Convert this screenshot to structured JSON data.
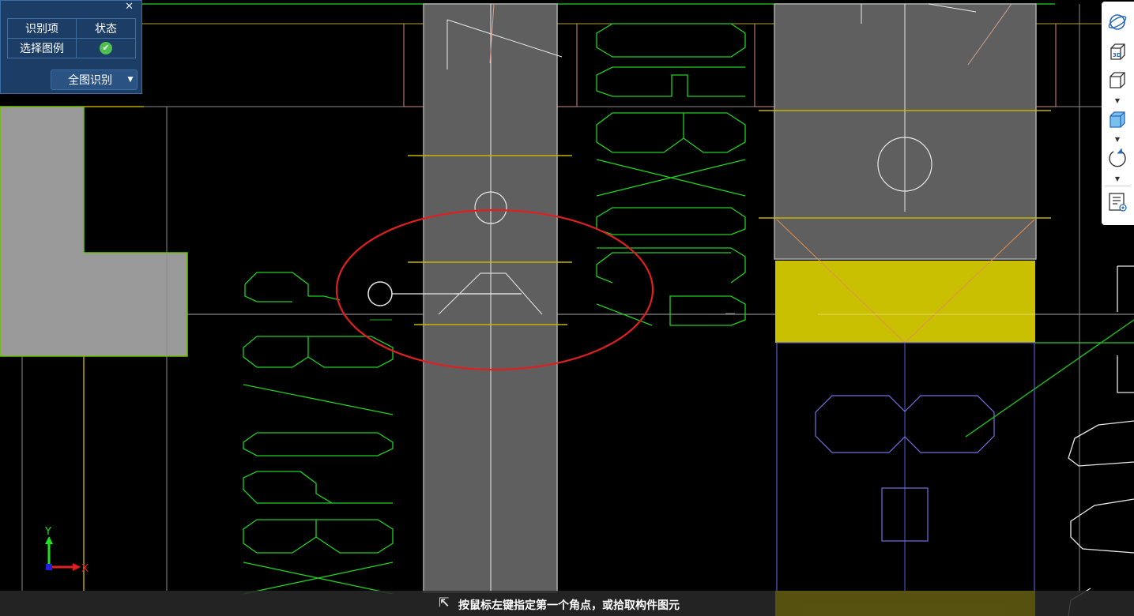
{
  "panel": {
    "close_icon": "close-icon",
    "header_item": "识别项",
    "header_status": "状态",
    "row_item": "选择图例",
    "row_status_icon": "check-circle-icon",
    "row_status_color": "#4fc04f",
    "action_button": "全图识别",
    "action_dropdown_icon": "caret-down-icon"
  },
  "toolbar": {
    "buttons": [
      {
        "icon": "orbit-icon"
      },
      {
        "icon": "3d-view-icon",
        "text": "3D"
      },
      {
        "icon": "cube-outline-icon"
      },
      {
        "icon": "cube-filled-icon"
      },
      {
        "icon": "rotate-icon"
      },
      {
        "icon": "display-settings-icon"
      }
    ]
  },
  "axis": {
    "x_label": "X",
    "y_label": "Y"
  },
  "status": {
    "icon": "pick-corner-icon",
    "prompt": "按鼠标左键指定第一个角点，或拾取构件图元"
  },
  "colors": {
    "panel_bg": "#1b3d66",
    "column_fill": "#5f5f5f",
    "highlight_fill": "#c8c000",
    "annotation_ellipse": "#e02020"
  }
}
